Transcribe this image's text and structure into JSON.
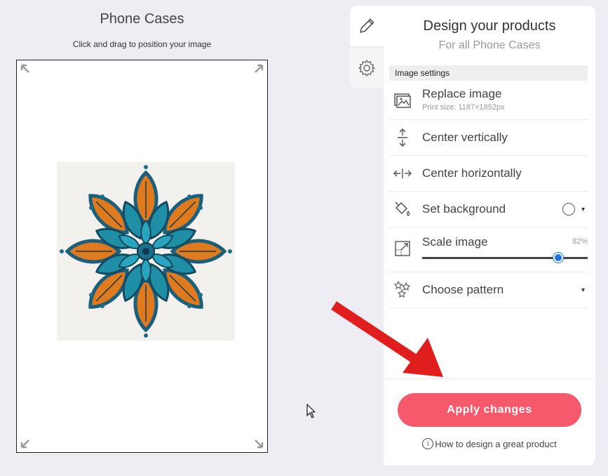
{
  "preview": {
    "title": "Phone Cases",
    "subtitle": "Click and drag to position your image"
  },
  "tabs": [
    {
      "icon": "pencil-icon",
      "active": true
    },
    {
      "icon": "gear-icon",
      "active": false
    }
  ],
  "panel": {
    "title": "Design your products",
    "subtitle": "For all Phone Cases",
    "section_header": "Image settings",
    "options": {
      "replace": {
        "label": "Replace image",
        "sub": "Print size: 1187×1852px",
        "icon": "image-icon"
      },
      "center_v": {
        "label": "Center vertically",
        "icon": "vertical-arrows-icon"
      },
      "center_h": {
        "label": "Center horizontally",
        "icon": "horizontal-arrows-icon"
      },
      "background": {
        "label": "Set background",
        "icon": "paint-bucket-icon",
        "caret": "▾",
        "swatch_color": "#ffffff"
      },
      "scale": {
        "label": "Scale image",
        "value_text": "82%",
        "value": 0.82,
        "icon": "scale-icon"
      },
      "pattern": {
        "label": "Choose pattern",
        "icon": "stars-icon",
        "caret": "▾"
      }
    },
    "apply_label": "Apply changes",
    "help_label": "How to design a great product",
    "info_glyph": "i"
  },
  "colors": {
    "accent": "#f5596b",
    "slider": "#1a73e8",
    "annotation_arrow": "#e01e1e"
  }
}
